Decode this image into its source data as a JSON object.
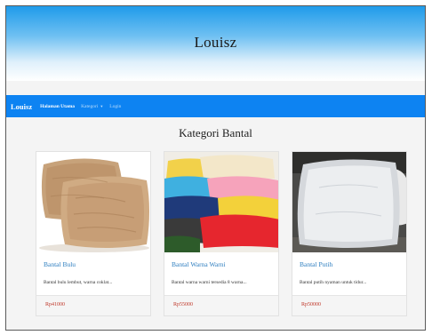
{
  "header": {
    "title": "Louisz"
  },
  "navbar": {
    "brand": "Louisz",
    "links": [
      {
        "label": "Halaman Utama"
      },
      {
        "label": "Kategori"
      },
      {
        "label": "Login"
      }
    ],
    "caret": "▼"
  },
  "page": {
    "heading": "Kategori Bantal"
  },
  "products": [
    {
      "title": "Bantal Bulu",
      "description": "Bantal bulu lembut, warna coklat...",
      "price": "Rp41000"
    },
    {
      "title": "Bantal Warna Warni",
      "description": "Bantal warna warni tersedia 8 warna...",
      "price": "Rp55000"
    },
    {
      "title": "Bantal Putih",
      "description": "Bantal putih nyaman untuk tidur...",
      "price": "Rp50000"
    }
  ],
  "colors": {
    "navbar": "#0d83f2",
    "title_link": "#2f7fc0",
    "price": "#c0392b"
  }
}
